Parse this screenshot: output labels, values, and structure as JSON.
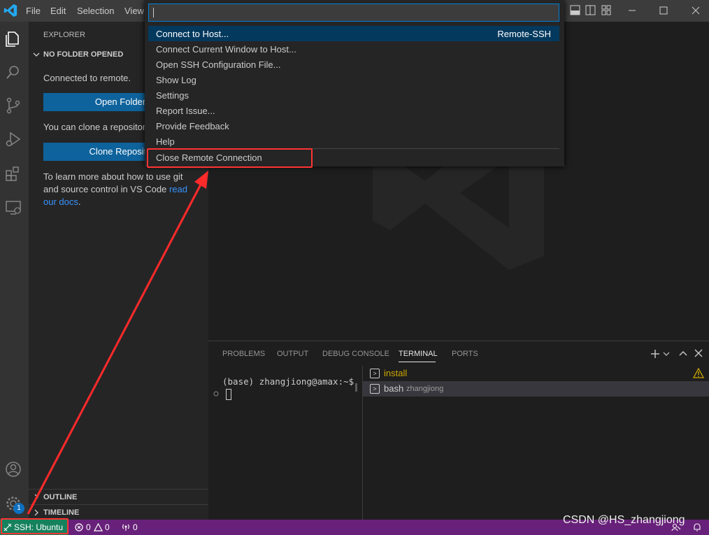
{
  "menu": [
    "File",
    "Edit",
    "Selection",
    "View"
  ],
  "sidebar": {
    "title": "EXPLORER",
    "section": "NO FOLDER OPENED",
    "connected_text": "Connected to remote.",
    "open_folder_label": "Open Folder",
    "clone_text": "You can clone a repositor",
    "clone_label": "Clone Reposito",
    "learn_line1": "To learn more about how to use git",
    "learn_line2": "and source control in VS Code",
    "learn_link1": "read",
    "learn_link2": "our docs",
    "learn_end": ".",
    "outline": "OUTLINE",
    "timeline": "TIMELINE"
  },
  "activity": {
    "badge": "1",
    "icons": [
      "explorer-icon",
      "search-icon",
      "source-control-icon",
      "run-debug-icon",
      "extensions-icon",
      "remote-explorer-icon",
      "account-icon",
      "settings-gear-icon"
    ]
  },
  "palette": {
    "input_value": "",
    "items": [
      {
        "label": "Connect to Host...",
        "kind": "Remote-SSH"
      },
      {
        "label": "Connect Current Window to Host..."
      },
      {
        "label": "Open SSH Configuration File..."
      },
      {
        "label": "Show Log"
      },
      {
        "label": "Settings"
      },
      {
        "label": "Report Issue..."
      },
      {
        "label": "Provide Feedback"
      },
      {
        "label": "Help"
      },
      {
        "label": "Close Remote Connection"
      }
    ]
  },
  "panel": {
    "tabs": [
      "PROBLEMS",
      "OUTPUT",
      "DEBUG CONSOLE",
      "TERMINAL",
      "PORTS"
    ],
    "active_tab": "TERMINAL",
    "prompt": "(base) zhangjiong@amax:~$",
    "terminals": [
      {
        "name": "install",
        "desc": "",
        "color": "#cca700"
      },
      {
        "name": "bash",
        "desc": "zhangjiong",
        "color": "#cccccc"
      }
    ]
  },
  "statusbar": {
    "remote": "SSH: Ubuntu",
    "errors": "0",
    "warnings": "0",
    "ports": "0"
  },
  "colors": {
    "statusbar": "#68217a",
    "remote": "#16825d",
    "accent": "#0e639c",
    "highlight": "#ff3333"
  },
  "watermark": "CSDN @HS_zhangjiong"
}
